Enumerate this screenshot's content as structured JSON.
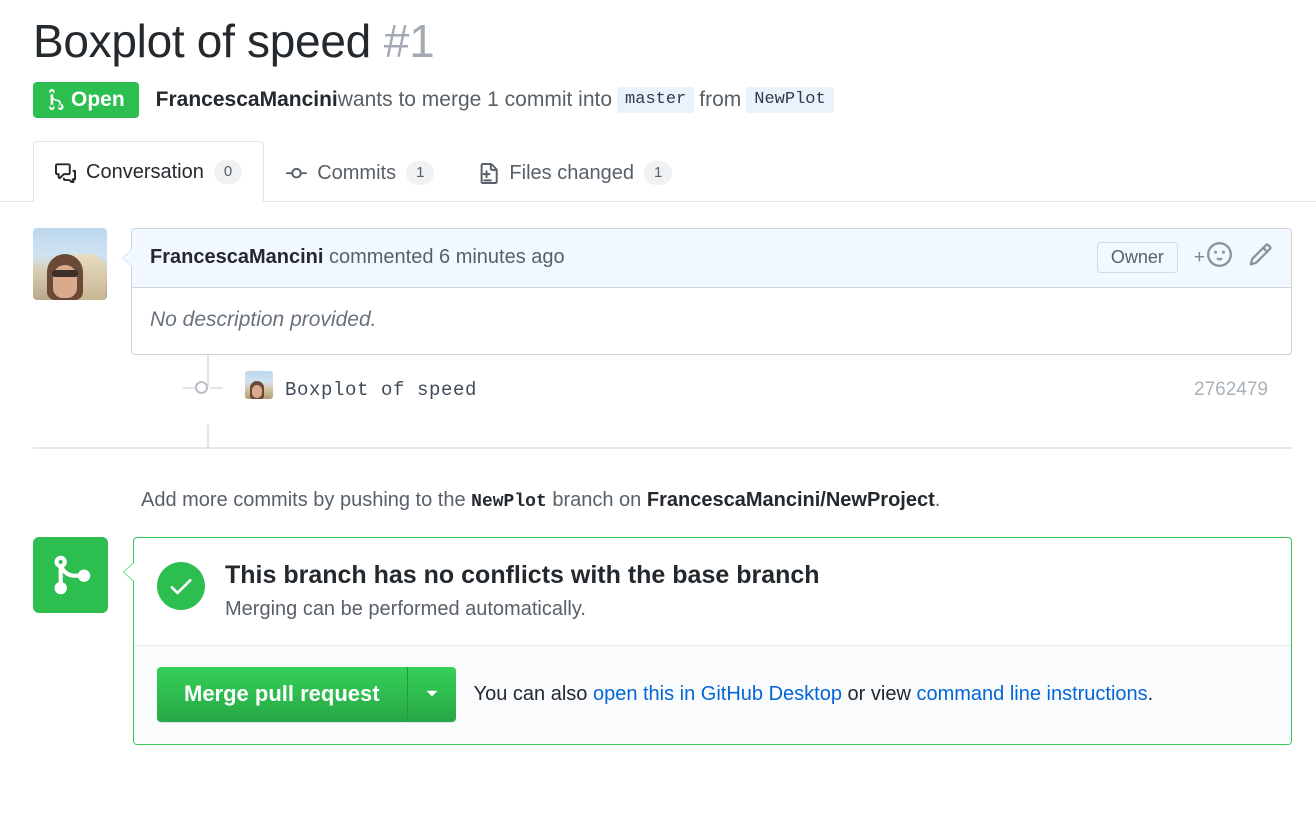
{
  "header": {
    "title": "Boxplot of speed",
    "number": "#1",
    "state_label": "Open",
    "state_icon": "git-pull-request-icon",
    "state_color": "#2cbe4e",
    "author": "FrancescaMancini",
    "action_text": " wants to merge 1 commit into ",
    "base_branch": "master",
    "from_text": "from",
    "head_branch": "NewPlot"
  },
  "tabs": [
    {
      "label": "Conversation",
      "count": "0",
      "icon": "comment-discussion-icon",
      "active": true
    },
    {
      "label": "Commits",
      "count": "1",
      "icon": "git-commit-icon",
      "active": false
    },
    {
      "label": "Files changed",
      "count": "1",
      "icon": "file-diff-icon",
      "active": false
    }
  ],
  "comment": {
    "author": "FrancescaMancini",
    "meta": " commented 6 minutes ago",
    "badge": "Owner",
    "add_reaction_icon": "smiley-plus-icon",
    "edit_icon": "pencil-icon",
    "body": "No description provided."
  },
  "commit": {
    "message": "Boxplot of speed",
    "sha": "2762479",
    "avatar": "user-avatar"
  },
  "push_note": {
    "prefix": "Add more commits by pushing to the ",
    "branch": "NewPlot",
    "middle": " branch on ",
    "repo": "FrancescaMancini/NewProject",
    "suffix": "."
  },
  "merge": {
    "icon": "git-merge-icon",
    "status_icon": "check-circle-icon",
    "status_title": "This branch has no conflicts with the base branch",
    "status_subtitle": "Merging can be performed automatically.",
    "button_label": "Merge pull request",
    "caret_icon": "chevron-down-icon",
    "alt_prefix": "You can also ",
    "alt_link1": "open this in GitHub Desktop",
    "alt_middle": " or view ",
    "alt_link2": "command line instructions",
    "alt_suffix": "."
  }
}
